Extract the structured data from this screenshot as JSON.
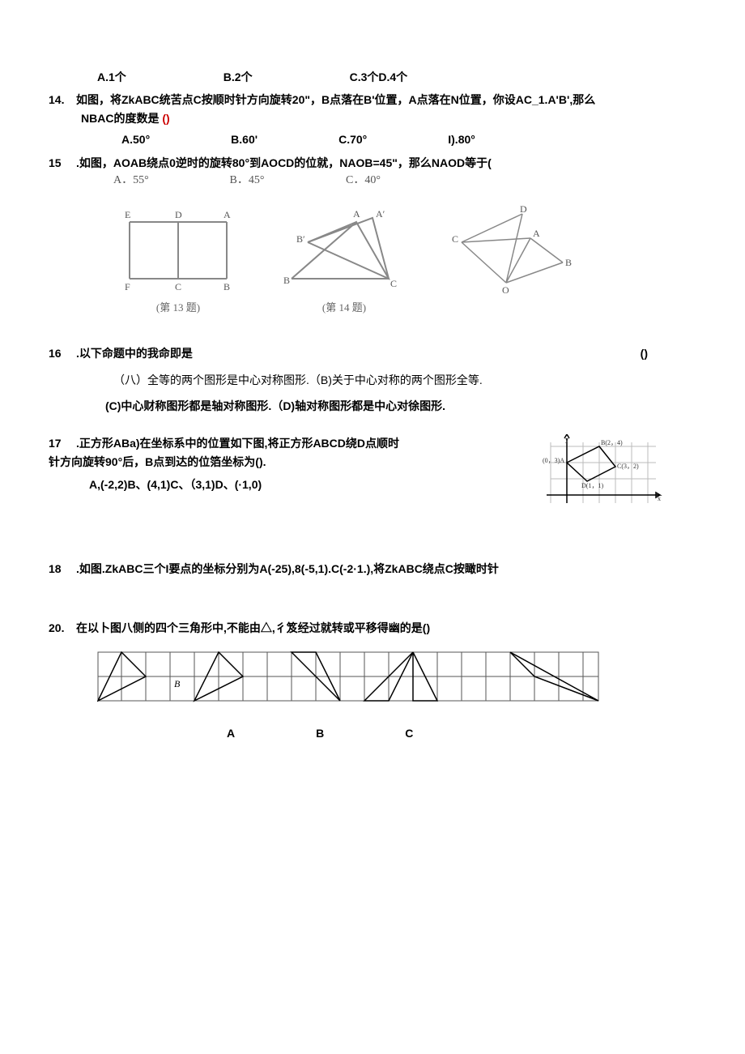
{
  "q13_options": {
    "a": "A.1个",
    "b": "B.2个",
    "cd": "C.3个D.4个"
  },
  "q14": {
    "num": "14.",
    "text1": "如图，将ZkABC统苦点C按顺时针方向旋转20\"，B点落在B'位置，A点落在N位置，你设AC_1.A'B',那么",
    "text2": "NBAC的度数是",
    "paren": "()",
    "opts": {
      "a": "A.50°",
      "b": "B.60'",
      "c": "C.70°",
      "d": "I).80°"
    }
  },
  "q15": {
    "num": "15",
    "text": ".如图，AOAB绕点0逆时的旋转80°到AOCD的位就，NAOB=45\"，那么NAOD等于(",
    "opts": {
      "a": "A．55°",
      "b": "B．45°",
      "c": "C．40°"
    }
  },
  "fig13_label": "(第 13 题)",
  "fig14_label": "(第 14 题)",
  "fig13_letters": {
    "E": "E",
    "D": "D",
    "A": "A",
    "F": "F",
    "C": "C",
    "B": "B"
  },
  "fig14_letters": {
    "A": "A",
    "Ap": "A′",
    "Bp": "B′",
    "B": "B",
    "C": "C"
  },
  "fig15_letters": {
    "D": "D",
    "A": "A",
    "C": "C",
    "B": "B",
    "O": "O"
  },
  "q16": {
    "num": "16",
    "text": ".以下命题中的我命即是",
    "paren": "()",
    "line2": "（八）全等的两个图形是中心对称图形.（B)关于中心对称的两个图形全等.",
    "line3": "(C)中心财称图形都是轴对称图形.（D)轴对称图形都是中心对徐图形."
  },
  "q17": {
    "num": "17",
    "text1": ".正方形ABa)在坐标系中的位置如下图,将正方形ABCD绕D点顺时",
    "text2": "针方向旋转90°后，B点到达的位箔坐标为().",
    "opts": "A,(-2,2)B、(4,1)C、（3,1)D、(·1,0)",
    "fig": {
      "B": "B(2，4)",
      "A": "(0，3)A",
      "C": "C(3，2)",
      "D": "D(1，1)",
      "y": "y",
      "x": "x"
    }
  },
  "q18": {
    "num": "18",
    "text": ".如图.ZkABC三个I要点的坐标分别为A(-25),8(-5,1).C(-2·1.),将ZkABC绕点C按瞰时针"
  },
  "q20": {
    "num": "20.",
    "text": "在以卜图八侧的四个三角形中,不能由△,彳笈经过就转或平移得幽的是()",
    "B": "B",
    "labels": {
      "A": "A",
      "Blab": "B",
      "C": "C"
    }
  }
}
